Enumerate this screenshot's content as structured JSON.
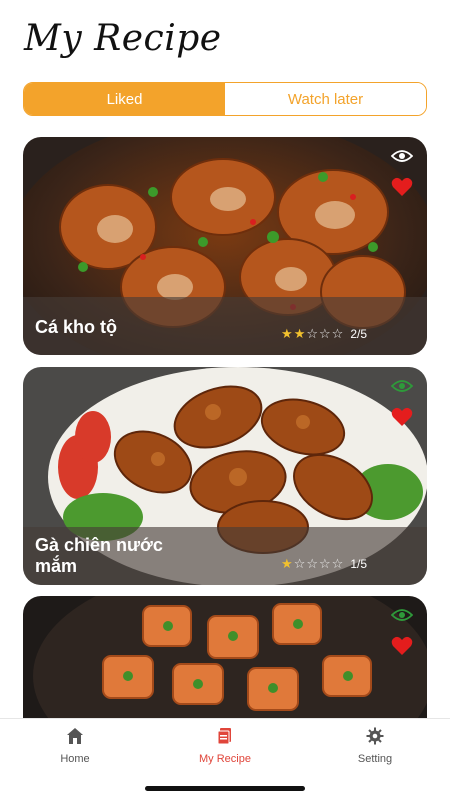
{
  "header": {
    "title": "My Recipe"
  },
  "tabs": {
    "liked": "Liked",
    "watch_later": "Watch later",
    "active": "Liked"
  },
  "cards": [
    {
      "name": "Cá kho tộ",
      "rating": 2,
      "max_rating": 5,
      "score_text": "2/5",
      "viewed": false,
      "liked": true
    },
    {
      "name": "Gà chiên nước mắm",
      "rating": 1,
      "max_rating": 5,
      "score_text": "1/5",
      "viewed": true,
      "liked": true
    },
    {
      "name": "",
      "viewed": true,
      "liked": true
    }
  ],
  "nav": {
    "home": "Home",
    "recipe": "My Recipe",
    "setting": "Setting",
    "active": "My Recipe"
  },
  "colors": {
    "accent": "#f3a32b",
    "nav_active": "#e0453a",
    "heart": "#e41d1d",
    "eye_viewed": "#2e9a3a",
    "eye_default": "#ffffff"
  },
  "icons": {
    "eye": "eye-icon",
    "heart": "heart-icon",
    "home": "home-icon",
    "recipe": "recipe-book-icon",
    "setting": "gear-icon"
  }
}
